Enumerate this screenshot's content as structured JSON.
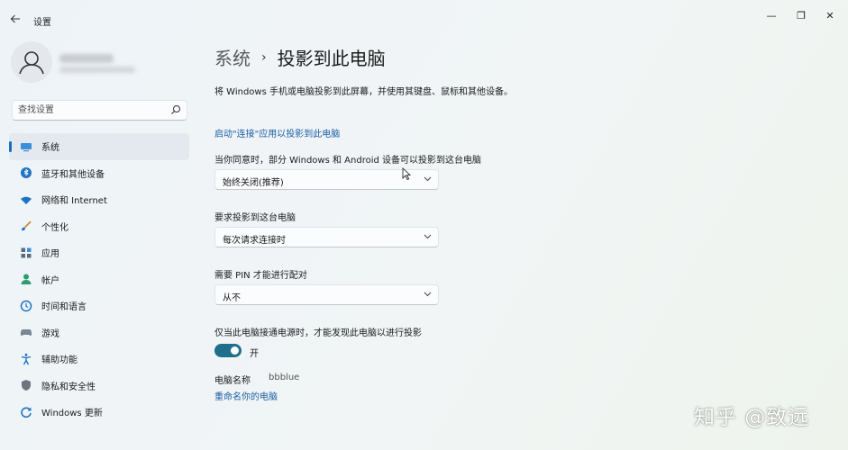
{
  "window": {
    "title": "设置",
    "controls": {
      "minimize": "—",
      "maximize": "❐",
      "close": "✕"
    }
  },
  "search": {
    "placeholder": "查找设置"
  },
  "sidebar": {
    "items": [
      {
        "label": "系统",
        "icon": "monitor-icon",
        "active": true
      },
      {
        "label": "蓝牙和其他设备",
        "icon": "bluetooth-icon",
        "active": false
      },
      {
        "label": "网络和 Internet",
        "icon": "wifi-icon",
        "active": false
      },
      {
        "label": "个性化",
        "icon": "brush-icon",
        "active": false
      },
      {
        "label": "应用",
        "icon": "apps-icon",
        "active": false
      },
      {
        "label": "帐户",
        "icon": "person-icon",
        "active": false
      },
      {
        "label": "时间和语言",
        "icon": "clock-globe-icon",
        "active": false
      },
      {
        "label": "游戏",
        "icon": "gamepad-icon",
        "active": false
      },
      {
        "label": "辅助功能",
        "icon": "accessibility-icon",
        "active": false
      },
      {
        "label": "隐私和安全性",
        "icon": "shield-icon",
        "active": false
      },
      {
        "label": "Windows 更新",
        "icon": "update-icon",
        "active": false
      }
    ]
  },
  "breadcrumb": {
    "parent": "系统",
    "separator": "›",
    "current": "投影到此电脑"
  },
  "main": {
    "description": "将 Windows 手机或电脑投影到此屏幕，并使用其键盘、鼠标和其他设备。",
    "launch_link": "启动\"连接\"应用以投影到此电脑",
    "setting1": {
      "label": "当你同意时，部分 Windows 和 Android 设备可以投影到这台电脑",
      "value": "始终关闭(推荐)"
    },
    "setting2": {
      "label": "要求投影到这台电脑",
      "value": "每次请求连接时"
    },
    "setting3": {
      "label": "需要 PIN 才能进行配对",
      "value": "从不"
    },
    "setting4": {
      "label": "仅当此电脑接通电源时，才能发现此电脑以进行投影",
      "toggle_state": "开",
      "toggle_on": true
    },
    "pc_name": {
      "label": "电脑名称",
      "value": "bbblue"
    },
    "rename_link": "重命名你的电脑"
  },
  "watermark": "知乎 @致远",
  "colors": {
    "accent": "#1a6fb7",
    "toggle": "#1f6f8b",
    "link": "#1a5fa3"
  }
}
